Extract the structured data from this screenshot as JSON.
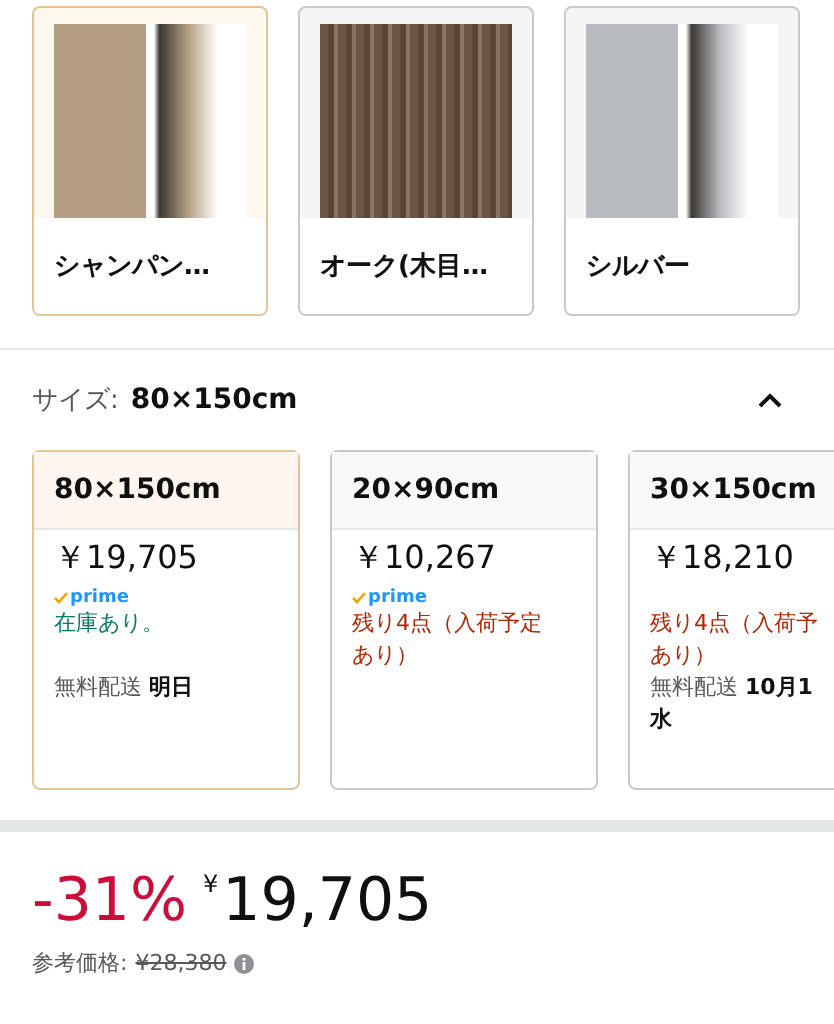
{
  "colors": [
    {
      "label": "シャンパン…",
      "selected": true,
      "color": "#b59f83"
    },
    {
      "label": "オーク(木目…",
      "selected": false,
      "color": "#6b5646"
    },
    {
      "label": "シルバー",
      "selected": false,
      "color": "#b9bdc2"
    }
  ],
  "size_section": {
    "label": "サイズ:",
    "value": "80×150cm",
    "expanded": true
  },
  "sizes": [
    {
      "name": "80×150cm",
      "selected": true,
      "price": "￥19,705",
      "prime": true,
      "prime_label": "prime",
      "in_stock": true,
      "stock_lines": [
        "在庫あり。"
      ],
      "delivery_label": "無料配送",
      "delivery_lines": [
        "明日"
      ]
    },
    {
      "name": "20×90cm",
      "selected": false,
      "price": "￥10,267",
      "prime": true,
      "prime_label": "prime",
      "in_stock": false,
      "stock_lines": [
        "残り4点（入荷予定",
        "あり）"
      ]
    },
    {
      "name": "30×150cm",
      "selected": false,
      "price": "￥18,210",
      "prime": false,
      "in_stock": false,
      "stock_lines": [
        "残り4点（入荷予",
        "あり）"
      ],
      "delivery_label": "無料配送",
      "delivery_lines": [
        "10月1",
        "水"
      ]
    }
  ],
  "price": {
    "discount": "-31%",
    "currency": "¥",
    "amount": "19,705",
    "reference_label": "参考価格:",
    "reference_price": "¥28,380"
  }
}
